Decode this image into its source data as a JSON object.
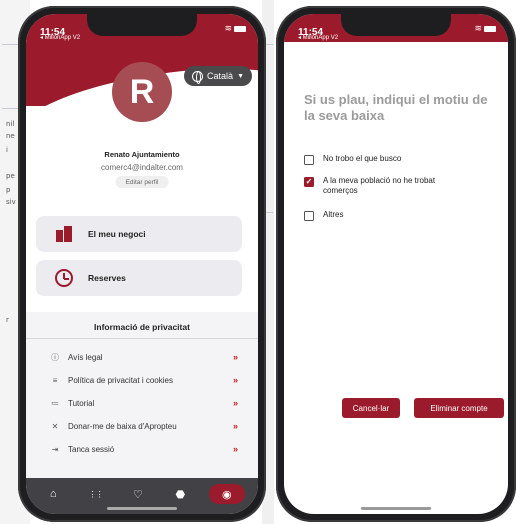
{
  "left": {
    "status": {
      "time": "11:54",
      "back_app": "◂ MillonApp V2"
    },
    "language": {
      "label": "Català"
    },
    "profile": {
      "initial": "R",
      "name": "Renato Ajuntamiento",
      "email": "comerc4@indalter.com",
      "edit_label": "Editar perfil"
    },
    "cards": [
      {
        "label": "El meu negoci",
        "icon": "building-icon"
      },
      {
        "label": "Reserves",
        "icon": "clock-icon"
      }
    ],
    "privacy": {
      "title": "Informació de privacitat",
      "items": [
        {
          "label": "Avís legal",
          "icon": "info-icon",
          "glyph": "ⓘ"
        },
        {
          "label": "Política de privacitat i cookies",
          "icon": "list-icon",
          "glyph": "≡"
        },
        {
          "label": "Tutorial",
          "icon": "bullet-list-icon",
          "glyph": "≔"
        },
        {
          "label": "Donar-me de baixa d'Apropteu",
          "icon": "close-icon",
          "glyph": "✕"
        },
        {
          "label": "Tanca sessió",
          "icon": "logout-icon",
          "glyph": "⇥"
        }
      ],
      "chevron": "»"
    },
    "tabs": [
      {
        "name": "home-icon",
        "glyph": "⌂"
      },
      {
        "name": "grid-icon",
        "glyph": "⋮⋮"
      },
      {
        "name": "heart-icon",
        "glyph": "♡"
      },
      {
        "name": "tag-icon",
        "glyph": "⬣"
      },
      {
        "name": "account-icon",
        "glyph": "◉"
      }
    ]
  },
  "right": {
    "status": {
      "time": "11:54",
      "back_app": "◂ MillonApp V2"
    },
    "question": "Si us plau, indiqui el motiu de la seva baixa",
    "options": [
      {
        "label": "No trobo el que busco",
        "checked": false
      },
      {
        "label": "A la meva població no he trobat comerços",
        "checked": true
      },
      {
        "label": "Altres",
        "checked": false
      }
    ],
    "cancel_label": "Cancel·lar",
    "delete_label": "Eliminar compte"
  },
  "background": {
    "fragments": [
      "nil",
      "ne",
      "i",
      "pe",
      "p",
      "siv",
      "r"
    ]
  },
  "colors": {
    "brand": "#9b1b2c",
    "tabbar": "#424246",
    "chevron": "#c41a1a"
  }
}
